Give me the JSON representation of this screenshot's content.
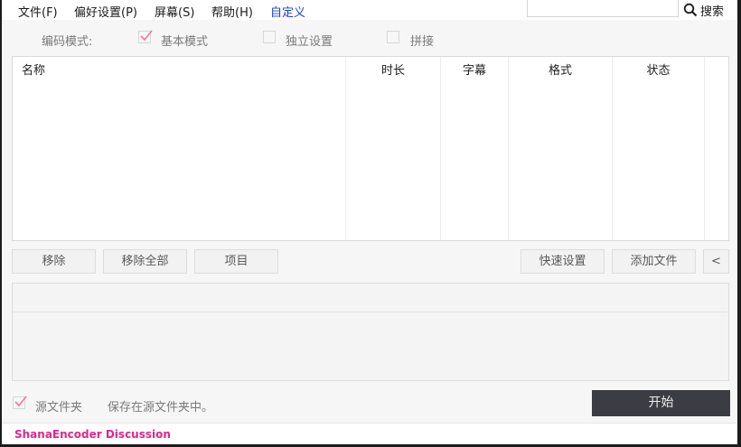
{
  "menu": {
    "items": [
      "文件(F)",
      "偏好设置(P)",
      "屏幕(S)",
      "帮助(H)",
      "自定义"
    ],
    "custom_color": "#1f3fd6"
  },
  "search": {
    "value": "",
    "button_label": "搜索",
    "icon": "magnifier-icon"
  },
  "encoding_mode": {
    "label": "编码模式:",
    "options": [
      {
        "label": "基本模式",
        "checked": true
      },
      {
        "label": "独立设置",
        "checked": false
      },
      {
        "label": "拼接",
        "checked": false
      }
    ]
  },
  "file_table": {
    "columns": [
      "名称",
      "时长",
      "字幕",
      "格式",
      "状态"
    ],
    "rows": []
  },
  "actions": {
    "remove": "移除",
    "remove_all": "移除全部",
    "item": "项目",
    "quick_settings": "快速设置",
    "add_file": "添加文件",
    "collapse": "<"
  },
  "output": {
    "source_folder_label": "源文件夹",
    "source_folder_checked": true,
    "save_hint": "保存在源文件夹中。"
  },
  "start_label": "开始",
  "status_bar": {
    "link_text": "ShanaEncoder Discussion",
    "link_color": "#e0258e"
  },
  "colors": {
    "check_mark": "#e87aa6",
    "start_button": "#3c3c44"
  }
}
